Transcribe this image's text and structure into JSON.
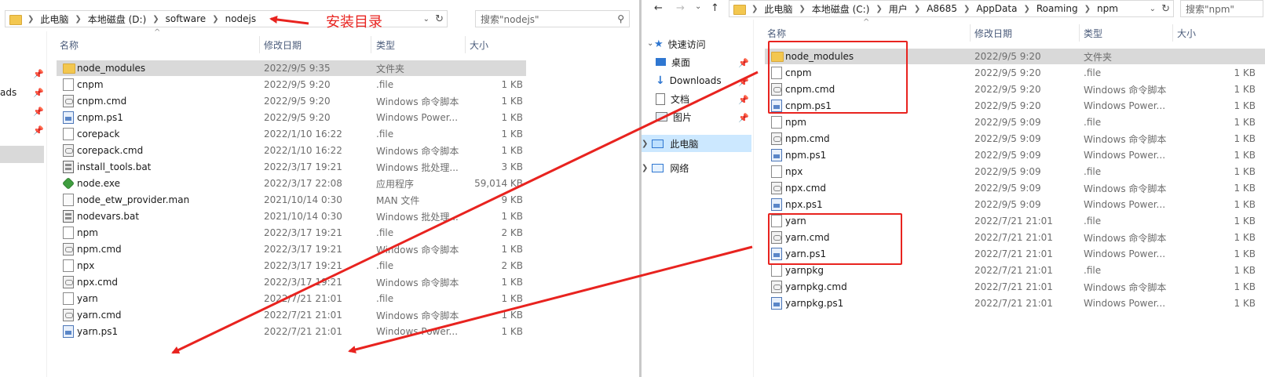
{
  "left": {
    "address": [
      "此电脑",
      "本地磁盘 (D:)",
      "software",
      "nodejs"
    ],
    "search_placeholder": "搜索\"nodejs\"",
    "annotation": "安装目录",
    "nav_partial": "ads",
    "columns": {
      "name": "名称",
      "date": "修改日期",
      "type": "类型",
      "size": "大小"
    },
    "files": [
      {
        "name": "node_modules",
        "date": "2022/9/5 9:35",
        "type": "文件夹",
        "size": "",
        "icon": "folder",
        "selected": true
      },
      {
        "name": "cnpm",
        "date": "2022/9/5 9:20",
        "type": ".file",
        "size": "1 KB",
        "icon": "file"
      },
      {
        "name": "cnpm.cmd",
        "date": "2022/9/5 9:20",
        "type": "Windows 命令脚本",
        "size": "1 KB",
        "icon": "cmd"
      },
      {
        "name": "cnpm.ps1",
        "date": "2022/9/5 9:20",
        "type": "Windows Power...",
        "size": "1 KB",
        "icon": "ps1"
      },
      {
        "name": "corepack",
        "date": "2022/1/10 16:22",
        "type": ".file",
        "size": "1 KB",
        "icon": "file"
      },
      {
        "name": "corepack.cmd",
        "date": "2022/1/10 16:22",
        "type": "Windows 命令脚本",
        "size": "1 KB",
        "icon": "cmd"
      },
      {
        "name": "install_tools.bat",
        "date": "2022/3/17 19:21",
        "type": "Windows 批处理...",
        "size": "3 KB",
        "icon": "bat"
      },
      {
        "name": "node.exe",
        "date": "2022/3/17 22:08",
        "type": "应用程序",
        "size": "59,014 KB",
        "icon": "exe"
      },
      {
        "name": "node_etw_provider.man",
        "date": "2021/10/14 0:30",
        "type": "MAN 文件",
        "size": "9 KB",
        "icon": "man"
      },
      {
        "name": "nodevars.bat",
        "date": "2021/10/14 0:30",
        "type": "Windows 批处理...",
        "size": "1 KB",
        "icon": "bat"
      },
      {
        "name": "npm",
        "date": "2022/3/17 19:21",
        "type": ".file",
        "size": "2 KB",
        "icon": "file"
      },
      {
        "name": "npm.cmd",
        "date": "2022/3/17 19:21",
        "type": "Windows 命令脚本",
        "size": "1 KB",
        "icon": "cmd"
      },
      {
        "name": "npx",
        "date": "2022/3/17 19:21",
        "type": ".file",
        "size": "2 KB",
        "icon": "file"
      },
      {
        "name": "npx.cmd",
        "date": "2022/3/17 19:21",
        "type": "Windows 命令脚本",
        "size": "1 KB",
        "icon": "cmd"
      },
      {
        "name": "yarn",
        "date": "2022/7/21 21:01",
        "type": ".file",
        "size": "1 KB",
        "icon": "file"
      },
      {
        "name": "yarn.cmd",
        "date": "2022/7/21 21:01",
        "type": "Windows 命令脚本",
        "size": "1 KB",
        "icon": "cmd"
      },
      {
        "name": "yarn.ps1",
        "date": "2022/7/21 21:01",
        "type": "Windows Power...",
        "size": "1 KB",
        "icon": "ps1"
      }
    ]
  },
  "right": {
    "address": [
      "此电脑",
      "本地磁盘 (C:)",
      "用户",
      "A8685",
      "AppData",
      "Roaming",
      "npm"
    ],
    "search_placeholder": "搜索\"npm\"",
    "nav": {
      "quick_access": "快速访问",
      "desktop": "桌面",
      "downloads": "Downloads",
      "documents": "文档",
      "pictures": "图片",
      "this_pc": "此电脑",
      "network": "网络"
    },
    "columns": {
      "name": "名称",
      "date": "修改日期",
      "type": "类型",
      "size": "大小"
    },
    "files": [
      {
        "name": "node_modules",
        "date": "2022/9/5 9:20",
        "type": "文件夹",
        "size": "",
        "icon": "folder",
        "selected": true
      },
      {
        "name": "cnpm",
        "date": "2022/9/5 9:20",
        "type": ".file",
        "size": "1 KB",
        "icon": "file"
      },
      {
        "name": "cnpm.cmd",
        "date": "2022/9/5 9:20",
        "type": "Windows 命令脚本",
        "size": "1 KB",
        "icon": "cmd"
      },
      {
        "name": "cnpm.ps1",
        "date": "2022/9/5 9:20",
        "type": "Windows Power...",
        "size": "1 KB",
        "icon": "ps1"
      },
      {
        "name": "npm",
        "date": "2022/9/5 9:09",
        "type": ".file",
        "size": "1 KB",
        "icon": "file"
      },
      {
        "name": "npm.cmd",
        "date": "2022/9/5 9:09",
        "type": "Windows 命令脚本",
        "size": "1 KB",
        "icon": "cmd"
      },
      {
        "name": "npm.ps1",
        "date": "2022/9/5 9:09",
        "type": "Windows Power...",
        "size": "1 KB",
        "icon": "ps1"
      },
      {
        "name": "npx",
        "date": "2022/9/5 9:09",
        "type": ".file",
        "size": "1 KB",
        "icon": "file"
      },
      {
        "name": "npx.cmd",
        "date": "2022/9/5 9:09",
        "type": "Windows 命令脚本",
        "size": "1 KB",
        "icon": "cmd"
      },
      {
        "name": "npx.ps1",
        "date": "2022/9/5 9:09",
        "type": "Windows Power...",
        "size": "1 KB",
        "icon": "ps1"
      },
      {
        "name": "yarn",
        "date": "2022/7/21 21:01",
        "type": ".file",
        "size": "1 KB",
        "icon": "file"
      },
      {
        "name": "yarn.cmd",
        "date": "2022/7/21 21:01",
        "type": "Windows 命令脚本",
        "size": "1 KB",
        "icon": "cmd"
      },
      {
        "name": "yarn.ps1",
        "date": "2022/7/21 21:01",
        "type": "Windows Power...",
        "size": "1 KB",
        "icon": "ps1"
      },
      {
        "name": "yarnpkg",
        "date": "2022/7/21 21:01",
        "type": ".file",
        "size": "1 KB",
        "icon": "file"
      },
      {
        "name": "yarnpkg.cmd",
        "date": "2022/7/21 21:01",
        "type": "Windows 命令脚本",
        "size": "1 KB",
        "icon": "cmd"
      },
      {
        "name": "yarnpkg.ps1",
        "date": "2022/7/21 21:01",
        "type": "Windows Power...",
        "size": "1 KB",
        "icon": "ps1"
      }
    ]
  },
  "colors": {
    "annotation": "#e8231f",
    "header_text": "#4a5b7a",
    "selected_row": "#d9d9d9",
    "nav_selected": "#cce8ff"
  }
}
